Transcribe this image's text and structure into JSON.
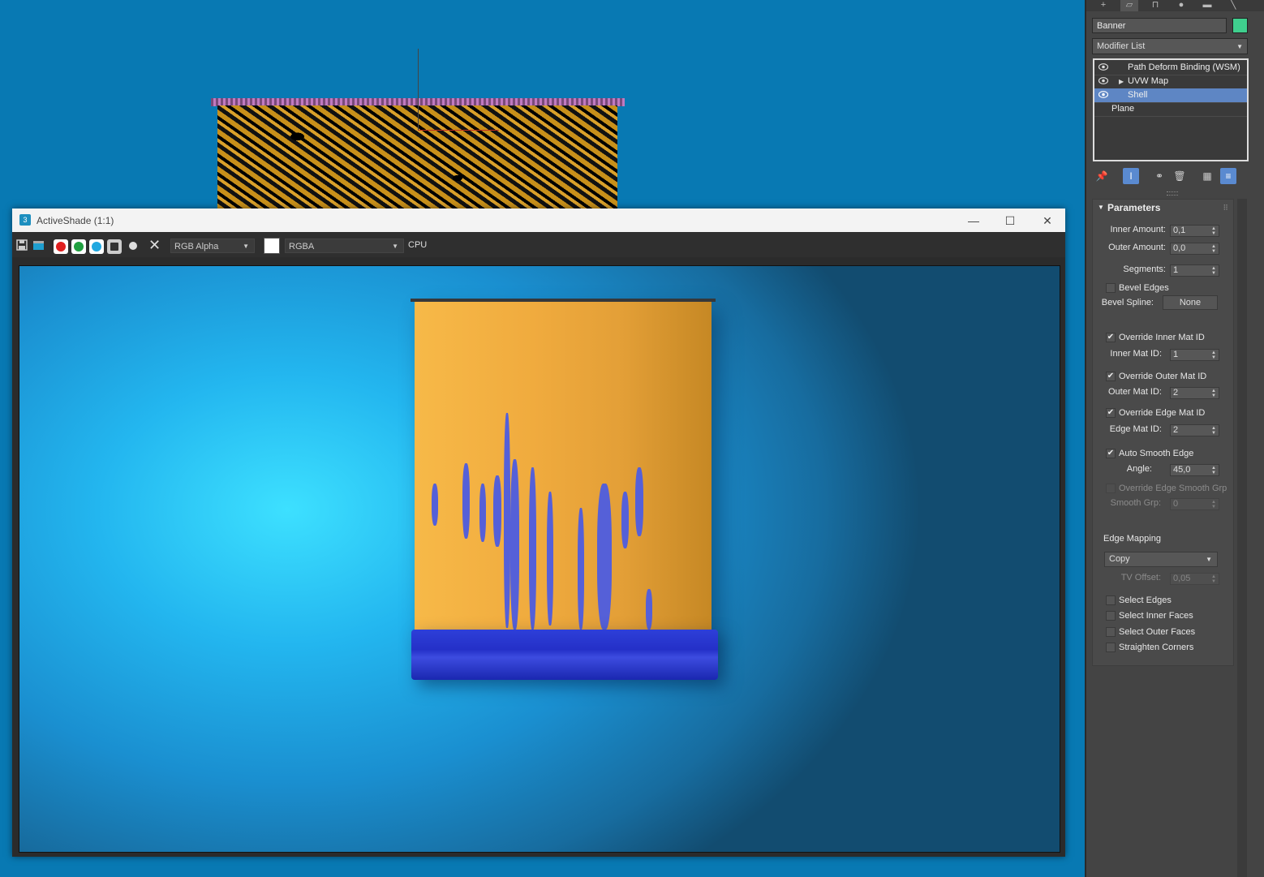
{
  "activeshade": {
    "title": "ActiveShade (1:1)",
    "app_icon": "3",
    "channel_select": "RGB Alpha",
    "display_select": "RGBA",
    "engine": "CPU",
    "controls": {
      "minimize": "—",
      "maximize": "☐",
      "close": "✕"
    }
  },
  "command_panel": {
    "object_name": "Banner",
    "object_color": "#3fcf8e",
    "modifier_list": "Modifier List",
    "stack": [
      {
        "label": "Path Deform Binding (WSM)",
        "eye": true,
        "expand": false,
        "selected": false
      },
      {
        "label": "UVW Map",
        "eye": true,
        "expand": true,
        "selected": false
      },
      {
        "label": "Shell",
        "eye": true,
        "expand": false,
        "selected": true
      },
      {
        "label": "Plane",
        "eye": false,
        "expand": false,
        "selected": false
      }
    ],
    "parameters": {
      "heading": "Parameters",
      "inner_amount_label": "Inner Amount:",
      "inner_amount": "0,1",
      "outer_amount_label": "Outer Amount:",
      "outer_amount": "0,0",
      "segments_label": "Segments:",
      "segments": "1",
      "bevel_edges": "Bevel Edges",
      "bevel_spline_label": "Bevel Spline:",
      "bevel_spline": "None",
      "override_inner_mat": "Override Inner Mat ID",
      "inner_mat_label": "Inner Mat ID:",
      "inner_mat": "1",
      "override_outer_mat": "Override Outer Mat ID",
      "outer_mat_label": "Outer Mat ID:",
      "outer_mat": "2",
      "override_edge_mat": "Override Edge Mat ID",
      "edge_mat_label": "Edge Mat ID:",
      "edge_mat": "2",
      "auto_smooth": "Auto Smooth Edge",
      "angle_label": "Angle:",
      "angle": "45,0",
      "override_smooth_grp": "Override Edge Smooth Grp",
      "smooth_grp_label": "Smooth Grp:",
      "smooth_grp": "0",
      "edge_mapping_label": "Edge Mapping",
      "edge_mapping": "Copy",
      "tv_offset_label": "TV Offset:",
      "tv_offset": "0,05",
      "select_edges": "Select Edges",
      "select_inner": "Select Inner Faces",
      "select_outer": "Select Outer Faces",
      "straighten": "Straighten Corners"
    }
  }
}
